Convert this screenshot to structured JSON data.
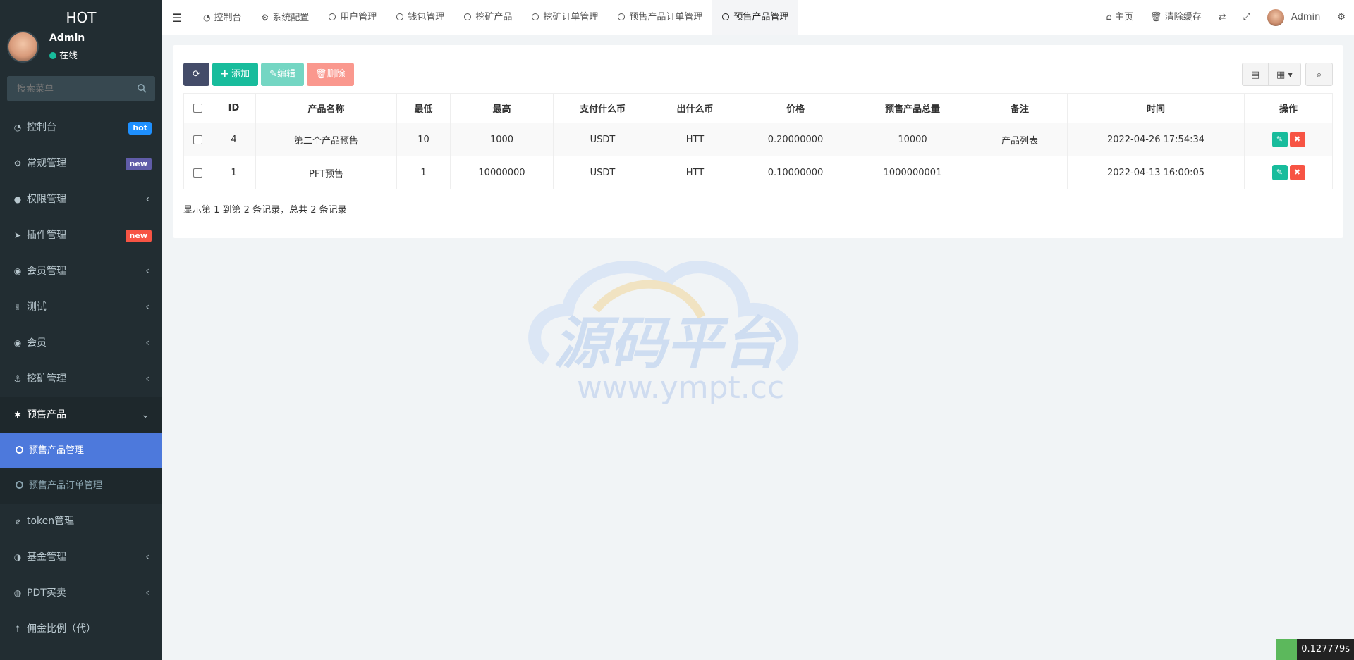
{
  "sidebar": {
    "logo": "HOT",
    "user": {
      "name": "Admin",
      "status": "在线"
    },
    "search_placeholder": "搜索菜单",
    "items": [
      {
        "label": "控制台",
        "icon": "dashboard-icon",
        "badge": "hot",
        "badge_color": "#1e90ff"
      },
      {
        "label": "常规管理",
        "icon": "cogs-icon",
        "badge": "new",
        "badge_color": "#605ca8"
      },
      {
        "label": "权限管理",
        "icon": "group-icon"
      },
      {
        "label": "插件管理",
        "icon": "rocket-icon",
        "badge": "new",
        "badge_color": "#f75444"
      },
      {
        "label": "会员管理",
        "icon": "user-circle-icon"
      },
      {
        "label": "测试",
        "icon": "medal-icon"
      },
      {
        "label": "会员",
        "icon": "user-circle-icon"
      },
      {
        "label": "挖矿管理",
        "icon": "anchor-icon"
      },
      {
        "label": "预售产品",
        "icon": "yelp-icon"
      },
      {
        "label": "token管理",
        "icon": "internet-explorer-icon"
      },
      {
        "label": "基金管理",
        "icon": "adjust-icon"
      },
      {
        "label": "PDT买卖",
        "icon": "compass-icon"
      },
      {
        "label": "佣金比例（代）",
        "icon": "child-icon"
      }
    ],
    "submenu": [
      {
        "label": "预售产品管理"
      },
      {
        "label": "预售产品订单管理"
      }
    ]
  },
  "topbar": {
    "tabs": [
      {
        "label": "控制台",
        "icon": "dashboard-icon"
      },
      {
        "label": "系统配置",
        "icon": "gear-icon"
      },
      {
        "label": "用户管理",
        "icon": "circle-icon"
      },
      {
        "label": "钱包管理",
        "icon": "circle-icon"
      },
      {
        "label": "挖矿产品",
        "icon": "circle-icon"
      },
      {
        "label": "挖矿订单管理",
        "icon": "circle-icon"
      },
      {
        "label": "预售产品订单管理",
        "icon": "circle-icon"
      },
      {
        "label": "预售产品管理",
        "icon": "circle-icon"
      }
    ],
    "home": "主页",
    "clear_cache": "清除缓存",
    "user": "Admin"
  },
  "toolbar": {
    "add": "添加",
    "edit": "编辑",
    "delete": "删除"
  },
  "table": {
    "headers": [
      "ID",
      "产品名称",
      "最低",
      "最高",
      "支付什么币",
      "出什么币",
      "价格",
      "预售产品总量",
      "备注",
      "时间",
      "操作"
    ],
    "rows": [
      {
        "id": "4",
        "name": "第二个产品预售",
        "min": "10",
        "max": "1000",
        "pay": "USDT",
        "out": "HTT",
        "price": "0.20000000",
        "total": "10000",
        "remark": "产品列表",
        "time": "2022-04-26 17:54:34"
      },
      {
        "id": "1",
        "name": "PFT预售",
        "min": "1",
        "max": "10000000",
        "pay": "USDT",
        "out": "HTT",
        "price": "0.10000000",
        "total": "1000000001",
        "remark": "",
        "time": "2022-04-13 16:00:05"
      }
    ]
  },
  "pagination": {
    "info": "显示第 1 到第 2 条记录，总共 2 条记录"
  },
  "watermark": {
    "title": "源码平台",
    "url": "www.ympt.cc"
  },
  "timing": "0.127779s",
  "colors": {
    "sidebar": "#222d32",
    "active_sub": "#4d79dc",
    "success": "#18bc9c",
    "danger": "#f75444",
    "primary_dark": "#444c69"
  }
}
